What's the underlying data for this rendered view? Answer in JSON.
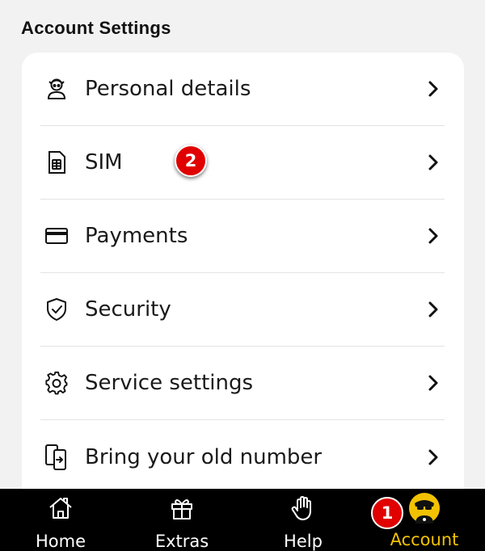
{
  "section_title": "Account Settings",
  "settings_items": [
    {
      "label": "Personal details",
      "icon": "person-icon"
    },
    {
      "label": "SIM",
      "icon": "sim-card-icon"
    },
    {
      "label": "Payments",
      "icon": "credit-card-icon"
    },
    {
      "label": "Security",
      "icon": "shield-check-icon"
    },
    {
      "label": "Service settings",
      "icon": "gear-icon"
    },
    {
      "label": "Bring your old number",
      "icon": "phone-transfer-icon"
    }
  ],
  "tabs": [
    {
      "label": "Home",
      "icon": "home-icon"
    },
    {
      "label": "Extras",
      "icon": "gift-icon"
    },
    {
      "label": "Help",
      "icon": "hand-icon"
    },
    {
      "label": "Account",
      "icon": "avatar-icon",
      "active": true
    }
  ],
  "annotations": {
    "badge_1": "1",
    "badge_2": "2"
  },
  "colors": {
    "accent": "#f2c200",
    "tabbar_bg": "#000000",
    "badge": "#e00000",
    "card_bg": "#ffffff",
    "page_bg": "#f2f2f2"
  }
}
